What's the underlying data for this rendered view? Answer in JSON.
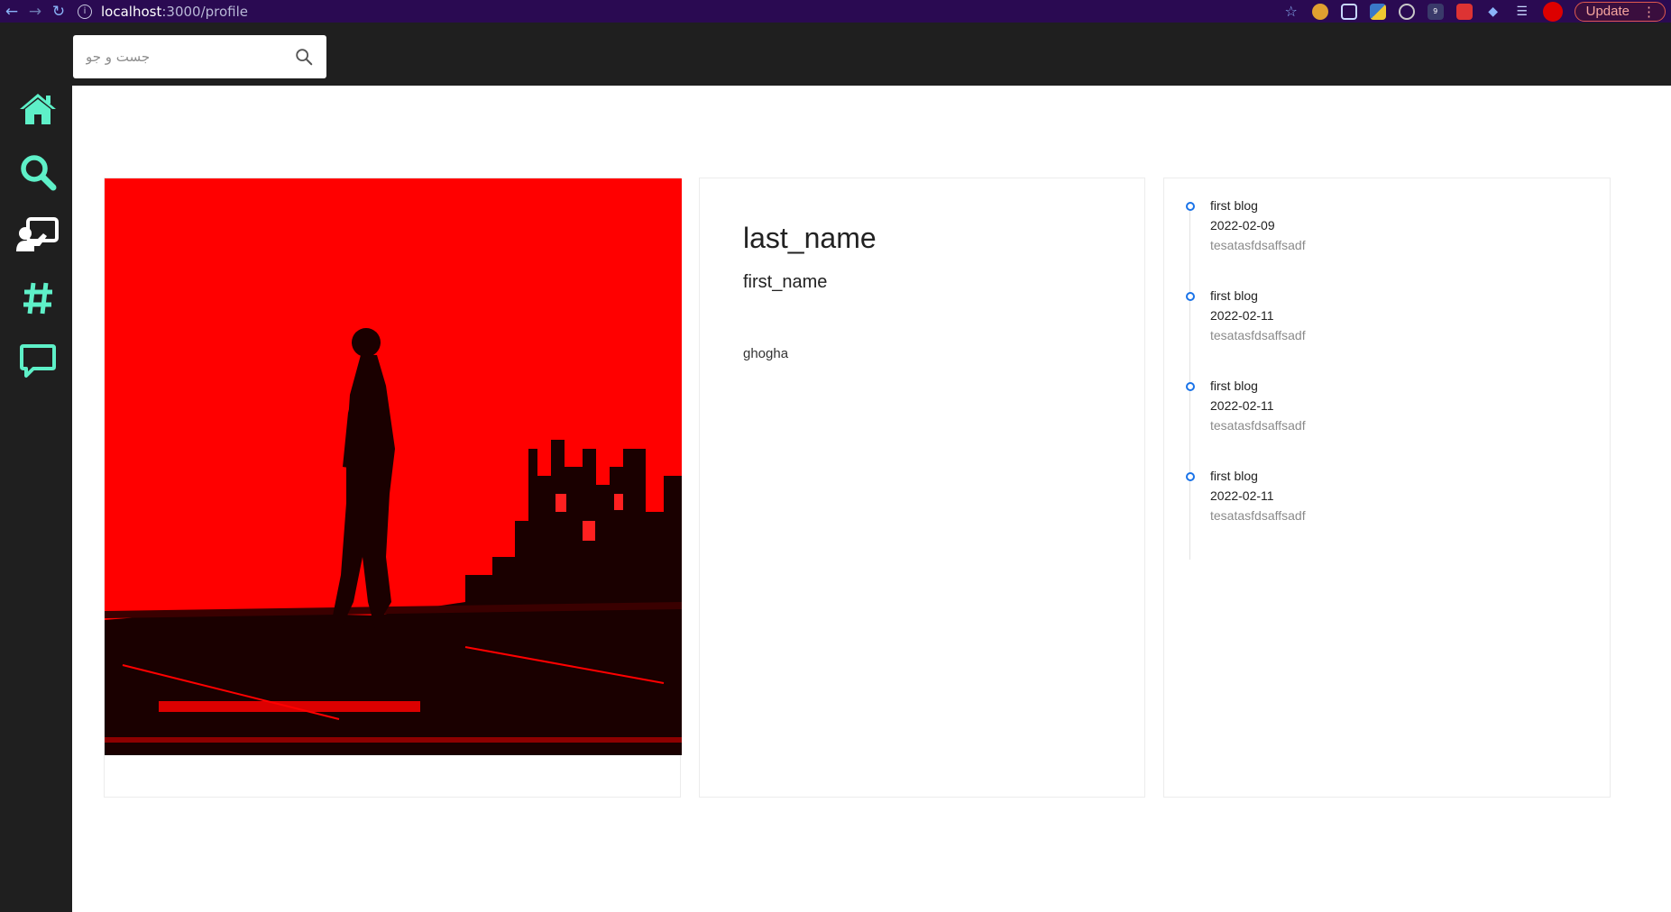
{
  "browser": {
    "url_host": "localhost",
    "url_path": ":3000/profile",
    "update_label": "Update"
  },
  "search": {
    "placeholder": "جست و جو"
  },
  "sidebar": {
    "items": [
      {
        "icon": "home-icon"
      },
      {
        "icon": "search-icon"
      },
      {
        "icon": "presentation-icon"
      },
      {
        "icon": "hashtag-icon"
      },
      {
        "icon": "chat-icon"
      }
    ],
    "accent": "#5ef0c8"
  },
  "profile": {
    "last_name": "last_name",
    "first_name": "first_name",
    "bio": "ghogha"
  },
  "timeline": [
    {
      "title": "first blog",
      "date": "2022-02-09",
      "desc": "tesatasfdsaffsadf"
    },
    {
      "title": "first blog",
      "date": "2022-02-11",
      "desc": "tesatasfdsaffsadf"
    },
    {
      "title": "first blog",
      "date": "2022-02-11",
      "desc": "tesatasfdsaffsadf"
    },
    {
      "title": "first blog",
      "date": "2022-02-11",
      "desc": "tesatasfdsaffsadf"
    }
  ]
}
